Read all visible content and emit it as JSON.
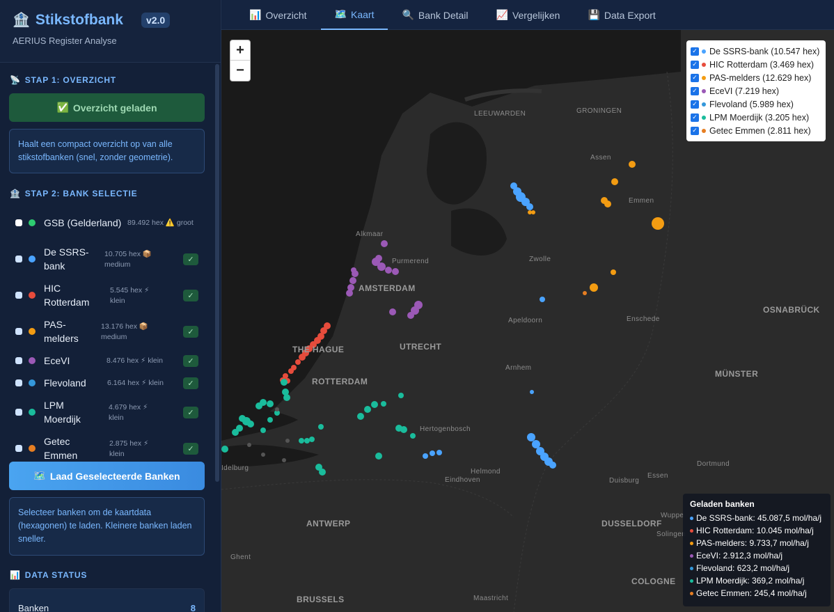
{
  "sidebar": {
    "title": "Stikstofbank",
    "version": "v2.0",
    "subtitle": "AERIUS Register Analyse",
    "step1_title": "STAP 1: OVERZICHT",
    "overview_button": "Overzicht geladen",
    "info1": "Haalt een compact overzicht op van alle stikstofbanken (snel, zonder geometrie).",
    "step2_title": "STAP 2: BANK SELECTIE",
    "banks": [
      {
        "name": "GSB (Gelderland)",
        "meta": "89.492 hex ⚠️ groot",
        "color": "#2ecc71",
        "checked": false
      },
      {
        "name": "De SSRS-bank",
        "meta": "10.705 hex 📦 medium",
        "color": "#4aa3ff",
        "checked": true
      },
      {
        "name": "HIC Rotterdam",
        "meta": "5.545 hex ⚡ klein",
        "color": "#e74c3c",
        "checked": true
      },
      {
        "name": "PAS-melders",
        "meta": "13.176 hex 📦 medium",
        "color": "#f39c12",
        "checked": true
      },
      {
        "name": "EceVI",
        "meta": "8.476 hex ⚡ klein",
        "color": "#9b59b6",
        "checked": true
      },
      {
        "name": "Flevoland",
        "meta": "6.164 hex ⚡ klein",
        "color": "#3498db",
        "checked": true
      },
      {
        "name": "LPM Moerdijk",
        "meta": "4.679 hex ⚡ klein",
        "color": "#1abc9c",
        "checked": true
      },
      {
        "name": "Getec Emmen",
        "meta": "2.875 hex ⚡ klein",
        "color": "#e67e22",
        "checked": true
      }
    ],
    "load_button": "Laad Geselecteerde Banken",
    "info2": "Selecteer banken om de kaartdata (hexagonen) te laden. Kleinere banken laden sneller.",
    "step3_title": "DATA STATUS",
    "status_label": "Banken",
    "status_value": "8"
  },
  "tabs": [
    {
      "icon": "📊",
      "label": "Overzicht"
    },
    {
      "icon": "🗺️",
      "label": "Kaart"
    },
    {
      "icon": "🔍",
      "label": "Bank Detail"
    },
    {
      "icon": "📈",
      "label": "Vergelijken"
    },
    {
      "icon": "💾",
      "label": "Data Export"
    }
  ],
  "map": {
    "zoom_in": "+",
    "zoom_out": "−",
    "legend": [
      {
        "label": "De SSRS-bank (10.547 hex)",
        "color": "#4aa3ff"
      },
      {
        "label": "HIC Rotterdam (3.469 hex)",
        "color": "#e74c3c"
      },
      {
        "label": "PAS-melders (12.629 hex)",
        "color": "#f39c12"
      },
      {
        "label": "EceVI (7.219 hex)",
        "color": "#9b59b6"
      },
      {
        "label": "Flevoland (5.989 hex)",
        "color": "#3498db"
      },
      {
        "label": "LPM Moerdijk (3.205 hex)",
        "color": "#1abc9c"
      },
      {
        "label": "Getec Emmen (2.811 hex)",
        "color": "#e67e22"
      }
    ],
    "loaded_title": "Geladen banken",
    "loaded": [
      {
        "label": "De SSRS-bank: 45.087,5 mol/ha/j",
        "color": "#4aa3ff"
      },
      {
        "label": "HIC Rotterdam: 10.045 mol/ha/j",
        "color": "#e74c3c"
      },
      {
        "label": "PAS-melders: 9.733,7 mol/ha/j",
        "color": "#f39c12"
      },
      {
        "label": "EceVI: 2.912,3 mol/ha/j",
        "color": "#9b59b6"
      },
      {
        "label": "Flevoland: 623,2 mol/ha/j",
        "color": "#3498db"
      },
      {
        "label": "LPM Moerdijk: 369,2 mol/ha/j",
        "color": "#1abc9c"
      },
      {
        "label": "Getec Emmen: 245,4 mol/ha/j",
        "color": "#e67e22"
      }
    ],
    "cities": {
      "leeuwarden": "LEEUWARDEN",
      "groningen": "GRONINGEN",
      "assen": "Assen",
      "emmen": "Emmen",
      "alkmaar": "Alkmaar",
      "purmerend": "Purmerend",
      "amsterdam": "AMSTERDAM",
      "zwolle": "Zwolle",
      "haag": "THE HAGUE",
      "utrecht": "UTRECHT",
      "apeldoorn": "Apeldoorn",
      "enschede": "Enschede",
      "osnabruck": "OSNABRÜCK",
      "rotterdam": "ROTTERDAM",
      "arnhem": "Arnhem",
      "munster": "MÜNSTER",
      "hertogenbosch": "Hertogenbosch",
      "helmond": "Helmond",
      "eindhoven": "Eindhoven",
      "dortmund": "Dortmund",
      "duisburg": "Duisburg",
      "essen": "Essen",
      "middelburg": "Idelburg",
      "antwerp": "ANTWERP",
      "dusseldorf": "DUSSELDORF",
      "wuppertal": "Wuppe",
      "solingen": "Solingen",
      "ghent": "Ghent",
      "cologne": "COLOGNE",
      "brussels": "BRUSSELS",
      "maastricht": "Maastricht"
    }
  }
}
